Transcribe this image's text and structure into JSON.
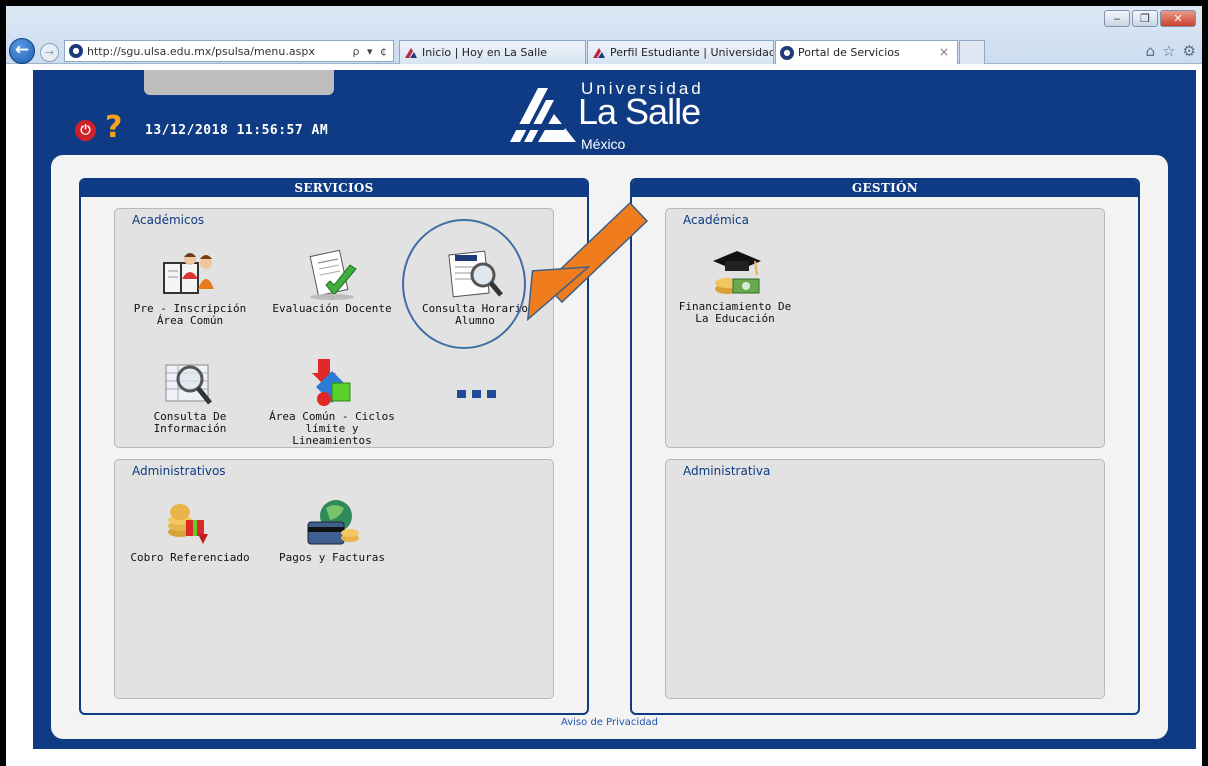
{
  "browser": {
    "address_url": "http://sgu.ulsa.edu.mx/psulsa/menu.aspx",
    "address_tools": "ρ ▾ ¢",
    "tabs": [
      {
        "label": "Inicio | Hoy en La Salle"
      },
      {
        "label": "Perfil Estudiante | Universidad ..."
      },
      {
        "label": "Portal de Servicios"
      }
    ],
    "tab_close": "×"
  },
  "header": {
    "help_symbol": "?",
    "datetime": "13/12/2018 11:56:57 AM",
    "logo": {
      "line1": "Universidad",
      "line2": "La Salle",
      "line3": "México"
    }
  },
  "servicios": {
    "title": "SERVICIOS",
    "academicos": {
      "title": "Académicos",
      "items": [
        {
          "label": "Pre - Inscripción Área Común",
          "icon": "student-book-icon"
        },
        {
          "label": "Evaluación Docente",
          "icon": "evaluation-check-icon"
        },
        {
          "label": "Consulta Horario Alumno",
          "icon": "schedule-magnifier-icon"
        },
        {
          "label": "Consulta De Información",
          "icon": "info-search-icon"
        },
        {
          "label": "Área Común - Ciclos límite y Lineamientos",
          "icon": "shapes-cycle-icon"
        }
      ]
    },
    "administrativos": {
      "title": "Administrativos",
      "items": [
        {
          "label": "Cobro Referenciado",
          "icon": "coins-gift-icon"
        },
        {
          "label": "Pagos y Facturas",
          "icon": "globe-card-icon"
        }
      ]
    }
  },
  "gestion": {
    "title": "GESTIÓN",
    "academica": {
      "title": "Académica",
      "items": [
        {
          "label": "Financiamiento De La Educación",
          "icon": "graduation-coins-icon"
        }
      ]
    },
    "administrativa": {
      "title": "Administrativa"
    }
  },
  "footer": {
    "privacy": "Aviso de Privacidad"
  },
  "colors": {
    "brand_blue": "#0e3b83",
    "annotation_orange": "#f07d1d"
  }
}
